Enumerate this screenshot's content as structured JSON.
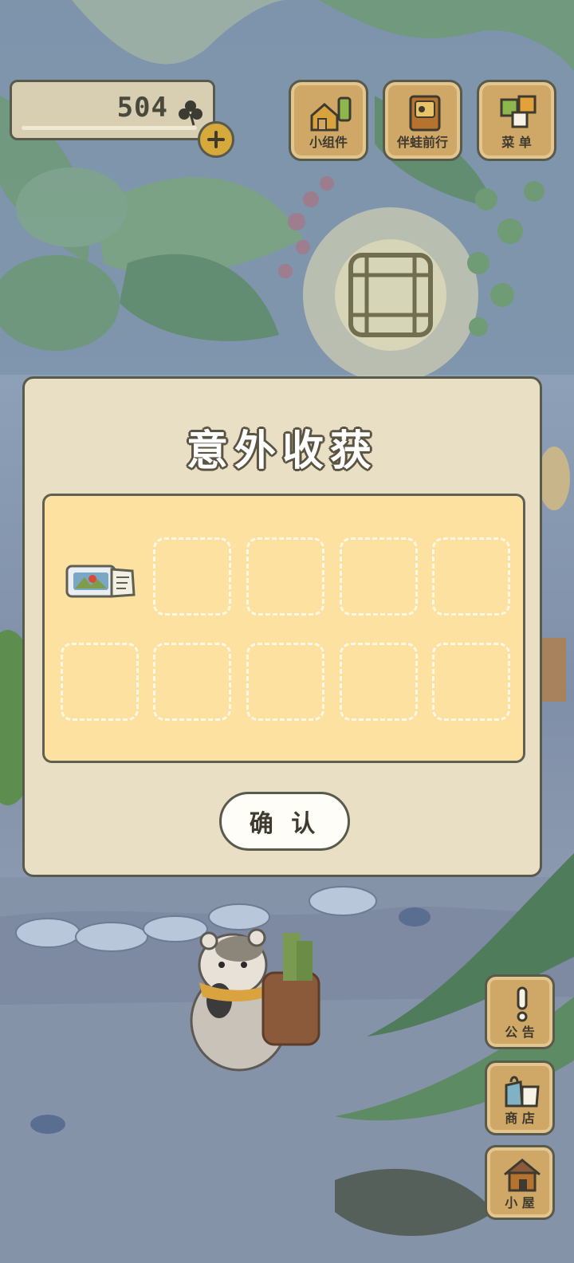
{
  "currency": {
    "amount": "504",
    "icon": "clover-icon"
  },
  "top_buttons": [
    {
      "label": "小组件",
      "icon": "widget-icon"
    },
    {
      "label": "伴蛙前行",
      "icon": "journal-icon"
    },
    {
      "label": "菜 单",
      "icon": "menu-icon"
    }
  ],
  "side_buttons": [
    {
      "label": "公 告",
      "icon": "exclamation-icon"
    },
    {
      "label": "商 店",
      "icon": "shop-bags-icon"
    },
    {
      "label": "小 屋",
      "icon": "house-icon"
    }
  ],
  "modal": {
    "title": "意外收获",
    "items": [
      {
        "icon": "ticket-icon",
        "filled": true
      },
      {
        "filled": false
      },
      {
        "filled": false
      },
      {
        "filled": false
      },
      {
        "filled": false
      },
      {
        "filled": false
      },
      {
        "filled": false
      },
      {
        "filled": false
      },
      {
        "filled": false
      },
      {
        "filled": false
      }
    ],
    "confirm_label": "确 认"
  },
  "colors": {
    "panel": "#e8dfc4",
    "slot_bg": "#fde1a0",
    "button_wood": "#cfa868",
    "outline": "#585a4c",
    "accent_gold": "#d7a93a"
  }
}
